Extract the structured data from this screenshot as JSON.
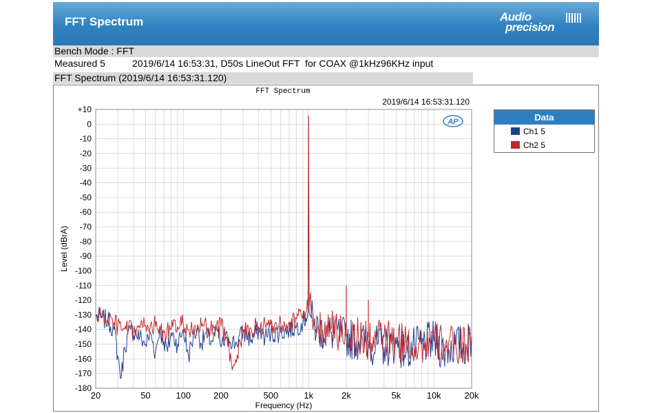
{
  "header": {
    "title": "FFT Spectrum",
    "logo_line1": "Audio",
    "logo_line2": "precision"
  },
  "info": {
    "bench_mode": "Bench Mode : FFT",
    "measured_label": "Measured 5",
    "measured_desc": "2019/6/14 16:53:31, D50s LineOut FFT  for COAX @1kHz96KHz input",
    "section_title": "FFT Spectrum (2019/6/14 16:53:31.120)"
  },
  "colors": {
    "header_bg": "#2f82c0",
    "ch1": "#1f3f8f",
    "ch2": "#c0282d",
    "grid": "#d3d3d3"
  },
  "chart_data": {
    "type": "line",
    "title": "FFT Spectrum",
    "timestamp": "2019/6/14 16:53:31.120",
    "watermark": "AP",
    "xlabel": "Frequency (Hz)",
    "ylabel": "Level (dBrA)",
    "x_scale": "log",
    "xlim": [
      20,
      20000
    ],
    "ylim": [
      -180,
      10
    ],
    "x_ticks": [
      20,
      50,
      100,
      200,
      500,
      1000,
      2000,
      5000,
      10000,
      20000
    ],
    "x_tick_labels": [
      "20",
      "50",
      "100",
      "200",
      "500",
      "1k",
      "2k",
      "5k",
      "10k",
      "20k"
    ],
    "y_ticks": [
      10,
      0,
      -10,
      -20,
      -30,
      -40,
      -50,
      -60,
      -70,
      -80,
      -90,
      -100,
      -110,
      -120,
      -130,
      -140,
      -150,
      -160,
      -170,
      -180
    ],
    "y_tick_labels": [
      "+10",
      "0",
      "-10",
      "-20",
      "-30",
      "-40",
      "-50",
      "-60",
      "-70",
      "-80",
      "-90",
      "-100",
      "-110",
      "-120",
      "-130",
      "-140",
      "-150",
      "-160",
      "-170",
      "-180"
    ],
    "grid": true,
    "legend": {
      "title": "Data",
      "placement": "right"
    },
    "series": [
      {
        "name": "Ch1 5",
        "color": "#1f3f8f",
        "x": [
          20,
          22,
          25,
          28,
          30,
          32,
          34,
          38,
          42,
          45,
          50,
          55,
          60,
          65,
          70,
          75,
          80,
          90,
          100,
          110,
          120,
          130,
          140,
          150,
          170,
          190,
          200,
          230,
          260,
          300,
          350,
          400,
          450,
          500,
          600,
          700,
          800,
          900,
          950,
          990,
          1000,
          1010,
          1050,
          1100,
          1200,
          1500,
          2000,
          2500,
          3000,
          4000,
          5000,
          6000,
          7000,
          8000,
          10000,
          12000,
          15000,
          18000,
          20000
        ],
        "y": [
          -131,
          -132,
          -134,
          -140,
          -158,
          -173,
          -152,
          -140,
          -143,
          -145,
          -150,
          -143,
          -156,
          -140,
          -148,
          -155,
          -142,
          -150,
          -140,
          -158,
          -145,
          -140,
          -150,
          -143,
          -148,
          -140,
          -152,
          -145,
          -150,
          -142,
          -147,
          -140,
          -145,
          -143,
          -142,
          -140,
          -138,
          -135,
          -132,
          -128,
          5,
          -128,
          -132,
          -137,
          -140,
          -142,
          -145,
          -148,
          -150,
          -152,
          -150,
          -155,
          -152,
          -150,
          -148,
          -155,
          -150,
          -152,
          -145
        ]
      },
      {
        "name": "Ch2 5",
        "color": "#c0282d",
        "x": [
          20,
          22,
          25,
          28,
          30,
          32,
          35,
          40,
          45,
          50,
          55,
          60,
          70,
          80,
          90,
          100,
          110,
          120,
          140,
          160,
          180,
          200,
          220,
          250,
          300,
          350,
          400,
          450,
          500,
          600,
          700,
          800,
          900,
          950,
          990,
          1000,
          1010,
          1050,
          1100,
          1200,
          1500,
          2000,
          2500,
          3000,
          4000,
          5000,
          6000,
          7000,
          8000,
          10000,
          12000,
          15000,
          18000,
          20000
        ],
        "y": [
          -130,
          -131,
          -133,
          -135,
          -138,
          -140,
          -140,
          -141,
          -139,
          -137,
          -136,
          -138,
          -142,
          -140,
          -138,
          -136,
          -140,
          -142,
          -138,
          -140,
          -142,
          -138,
          -145,
          -165,
          -142,
          -140,
          -138,
          -137,
          -137,
          -136,
          -135,
          -133,
          -130,
          -128,
          -126,
          6,
          -126,
          -130,
          -135,
          -138,
          -140,
          -143,
          -145,
          -148,
          -145,
          -150,
          -148,
          -152,
          -150,
          -148,
          -150,
          -152,
          -150,
          -147
        ]
      }
    ],
    "annotations": [
      {
        "x": 2000,
        "y": -110,
        "series": "Ch2 5",
        "note": "spur"
      },
      {
        "x": 3000,
        "y": -120,
        "series": "Ch2 5",
        "note": "spur"
      }
    ]
  }
}
